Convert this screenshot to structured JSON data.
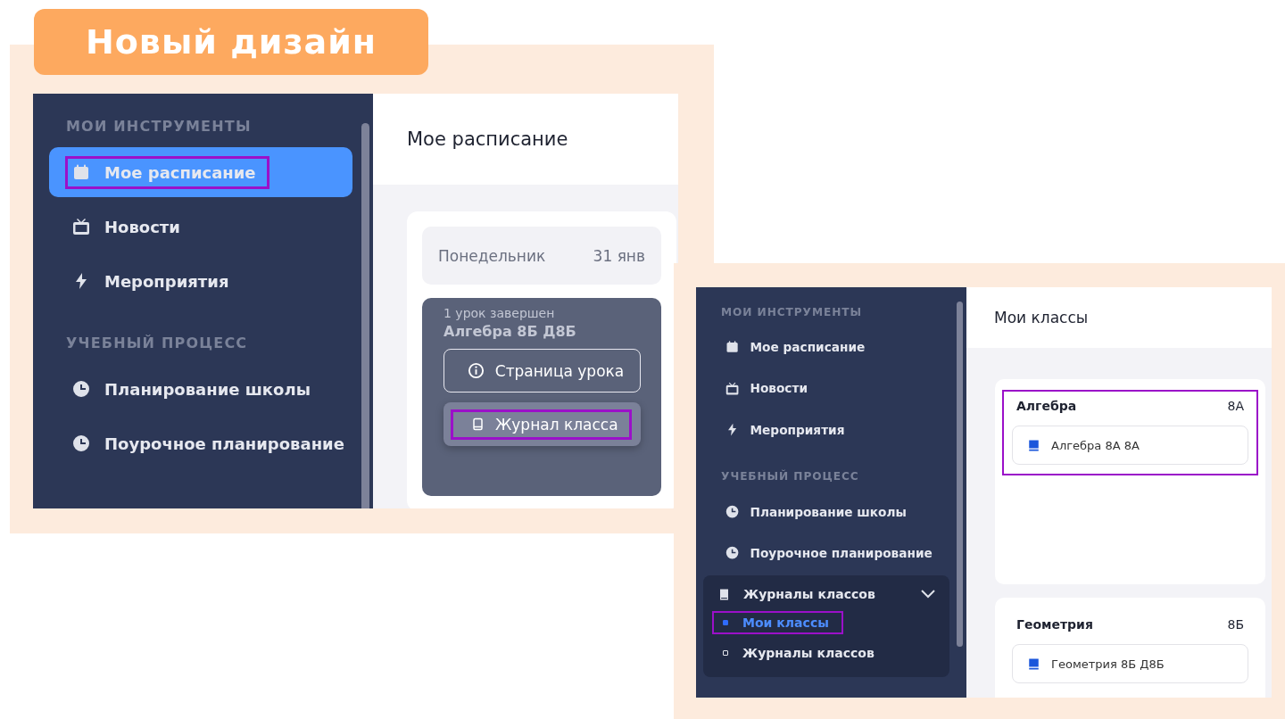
{
  "banner": {
    "title": "Новый дизайн"
  },
  "old_screen": {
    "sidebar": {
      "sections": [
        {
          "title": "МОИ ИНСТРУМЕНТЫ",
          "items": [
            {
              "label": "Мое расписание",
              "kind": "calendar",
              "selected": true,
              "highlighted": true
            },
            {
              "label": "Новости",
              "kind": "tv",
              "selected": false,
              "highlighted": false
            },
            {
              "label": "Мероприятия",
              "kind": "bolt",
              "selected": false,
              "highlighted": false
            }
          ]
        },
        {
          "title": "УЧЕБНЫЙ ПРОЦЕСС",
          "items": [
            {
              "label": "Планирование школы",
              "kind": "clock",
              "selected": false,
              "highlighted": false
            },
            {
              "label": "Поурочное планирование",
              "kind": "clock",
              "selected": false,
              "highlighted": false
            }
          ]
        }
      ]
    },
    "header_title": "Мое расписание",
    "day": {
      "name": "Понедельник",
      "date": "31 янв"
    },
    "lesson": {
      "status": "1 урок завершен",
      "title": "Алгебра 8Б Д8Б"
    },
    "actions": [
      {
        "label": "Страница урока",
        "kind": "outline",
        "highlighted": false
      },
      {
        "label": "Журнал класса",
        "kind": "filled",
        "highlighted": true
      }
    ]
  },
  "new_screen": {
    "sidebar": {
      "sections": [
        {
          "title": "МОИ ИНСТРУМЕНТЫ",
          "items": [
            {
              "label": "Мое расписание",
              "kind": "calendar",
              "selected": false,
              "highlighted": false
            },
            {
              "label": "Новости",
              "kind": "tv",
              "selected": false,
              "highlighted": false
            },
            {
              "label": "Мероприятия",
              "kind": "bolt",
              "selected": false,
              "highlighted": false
            }
          ]
        },
        {
          "title": "УЧЕБНЫЙ ПРОЦЕСС",
          "items": [
            {
              "label": "Планирование школы",
              "kind": "clock",
              "selected": false,
              "highlighted": false
            },
            {
              "label": "Поурочное планирование",
              "kind": "clock",
              "selected": false,
              "highlighted": false
            }
          ]
        }
      ],
      "group": {
        "label": "Журналы классов",
        "kind": "book",
        "expanded": true,
        "children": [
          {
            "label": "Мои классы",
            "selected": true,
            "highlighted": true
          },
          {
            "label": "Журналы классов",
            "selected": false,
            "highlighted": false
          }
        ]
      }
    },
    "header_title": "Мои классы",
    "classes": [
      {
        "subject": "Алгебра",
        "grade": "8А",
        "journal": "Алгебра 8А 8А",
        "highlighted": true
      },
      {
        "subject": "Геометрия",
        "grade": "8Б",
        "journal": "Геометрия 8Б Д8Б",
        "highlighted": false
      }
    ]
  }
}
